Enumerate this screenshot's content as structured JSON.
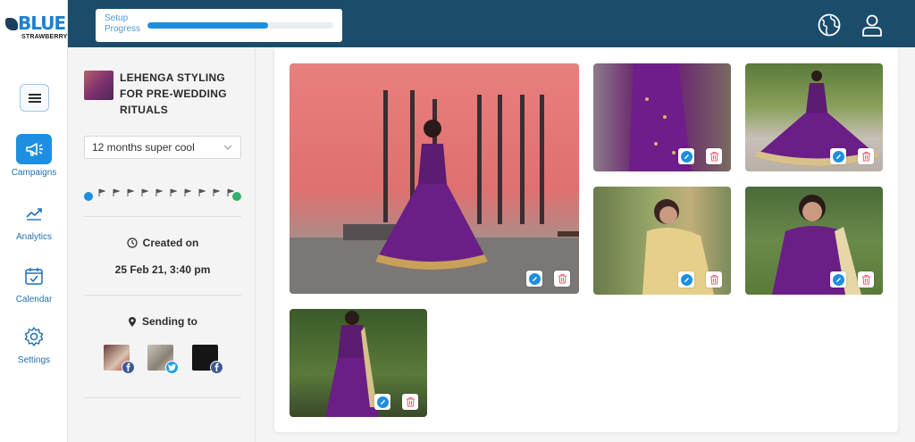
{
  "brand": {
    "name": "BLUE",
    "sub": "STRAWBERRY"
  },
  "header": {
    "progress_label": "Setup Progress",
    "progress_fraction": 0.65
  },
  "nav": {
    "items": [
      {
        "label": "Campaigns",
        "icon": "megaphone-icon",
        "active": true
      },
      {
        "label": "Analytics",
        "icon": "trend-line-icon",
        "active": false
      },
      {
        "label": "Calendar",
        "icon": "calendar-check-icon",
        "active": false
      },
      {
        "label": "Settings",
        "icon": "gear-icon",
        "active": false
      }
    ]
  },
  "campaign": {
    "title": "LEHENGA STYLING FOR PRE-WEDDING RITUALS",
    "duration_selected": "12 months super cool",
    "created_label": "Created on",
    "created_value": "25 Feb 21, 3:40 pm",
    "sending_label": "Sending to",
    "channels": [
      {
        "network": "facebook"
      },
      {
        "network": "twitter"
      },
      {
        "network": "facebook"
      }
    ]
  },
  "colors": {
    "accent": "#1e8fe0",
    "header_bg": "#1b4d6b",
    "timeline_end": "#2fb36a",
    "delete": "#e85d75",
    "facebook": "#3b5998",
    "twitter": "#1da1f2"
  },
  "gallery": {
    "photo_count": 6
  }
}
